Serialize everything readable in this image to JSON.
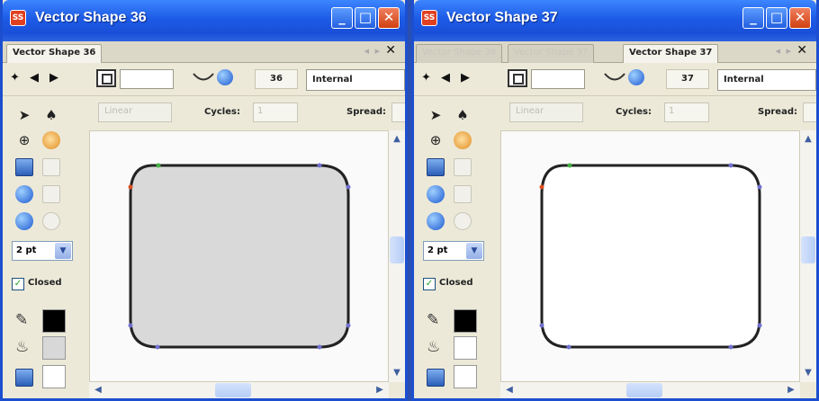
{
  "windows": [
    {
      "title": "Vector Shape 36",
      "tabs": [
        {
          "label": "Vector Shape 36",
          "active": true
        }
      ],
      "pen_size": "36",
      "join_mode": "Internal",
      "stroke_width": "2 pt",
      "closed_label": "Closed",
      "closed_checked": true,
      "gradient_placeholder": "Linear",
      "cycles_label": "Cycles:",
      "cycles_value": "1",
      "spread_label": "Spread:",
      "shape_fill": "#d9d9d9",
      "stroke_color": "#222222"
    },
    {
      "title": "Vector Shape 37",
      "tabs": [
        {
          "label": "Vector Shape 36",
          "active": false
        },
        {
          "label": "Vector Shape 37",
          "active": false
        },
        {
          "label": "Vector Shape 37",
          "active": true
        }
      ],
      "pen_size": "37",
      "join_mode": "Internal",
      "stroke_width": "2 pt",
      "closed_label": "Closed",
      "closed_checked": true,
      "gradient_placeholder": "Linear",
      "cycles_label": "Cycles:",
      "cycles_value": "1",
      "spread_label": "Spread:",
      "shape_fill": "#ffffff",
      "stroke_color": "#222222"
    }
  ],
  "icons": {
    "app": "app-logo-icon",
    "minimize": "minimize-icon",
    "maximize": "maximize-icon",
    "close": "close-icon",
    "arrow_tool": "arrow-pointer-icon",
    "pen_tool": "pen-nib-icon",
    "globe": "globe-icon",
    "gear": "gear-icon",
    "rect": "rectangle-icon",
    "ellipse": "ellipse-icon",
    "pencil": "pencil-icon",
    "bucket": "fill-bucket-icon",
    "preview": "preview-icon"
  },
  "colors": {
    "title_bar": "#1d5be6",
    "window_bg": "#ece9d8",
    "node_red": "#e05020",
    "node_green": "#40b040",
    "node_purple": "#7070d0"
  }
}
